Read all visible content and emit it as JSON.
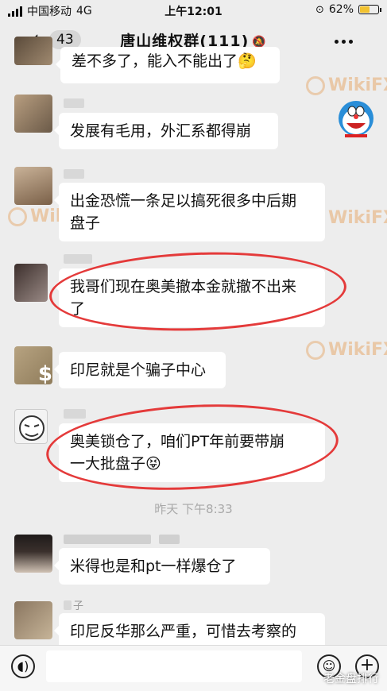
{
  "status_bar": {
    "carrier": "中国移动",
    "network": "4G",
    "time": "上午12:01",
    "battery_percent": "62%",
    "battery_level": 0.62
  },
  "header": {
    "back_icon": "chevron-left-icon",
    "unread_count": "43",
    "title": "唐山维权群(111)",
    "mute_icon": "bell-off-icon",
    "more_icon": "ellipsis-icon"
  },
  "messages": [
    {
      "text_lines": [
        "差不多了，能入不能出了",
        "🤔"
      ]
    },
    {
      "text_lines": [
        "发展有毛用，外汇系都得崩"
      ]
    },
    {
      "text_lines": [
        "出金恐慌一条足以搞死很多中后期",
        "盘子"
      ]
    },
    {
      "text_lines": [
        "我哥们现在奥美撤本金就撤不出来",
        "了"
      ]
    },
    {
      "text_lines": [
        "印尼就是个骗子中心"
      ]
    },
    {
      "text_lines": [
        "奥美锁仓了，咱们PT年前要带崩",
        "一大批盘子😝"
      ]
    },
    {
      "text_lines": [
        "米得也是和pt一样爆仓了"
      ]
    },
    {
      "text_lines": [
        "印尼反华那么严重，可惜去考察的"
      ]
    }
  ],
  "time_divider": "昨天 下午8:33",
  "partial_nickname": "子",
  "avatar_label": "$",
  "watermark_text": "WikiFX",
  "wechat_watermark": "老金盘排行",
  "input_bar": {
    "voice_icon": "voice-icon",
    "emoji_icon": "emoji-icon",
    "plus_icon": "plus-icon"
  },
  "colors": {
    "background": "#ededed",
    "bubble": "#ffffff",
    "highlight_circle": "#e43a3a",
    "watermark": "#e6aa6e"
  }
}
